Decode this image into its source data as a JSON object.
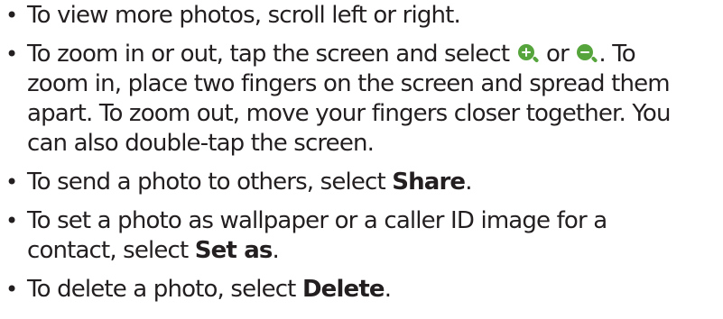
{
  "icon_color": "#56a43c",
  "bullet": "•",
  "items": [
    {
      "lines": [
        "To view more photos, scroll left or right."
      ]
    },
    {
      "line1_before": "To zoom in or out, tap the screen and select",
      "zoom_in_icon": "zoom-in-icon",
      "or": "or",
      "zoom_out_icon": "zoom-out-icon",
      "line1_after": ". To",
      "lines": [
        "zoom in, place two fingers on the screen and spread them",
        "apart. To zoom out, move your fingers closer together. You",
        "can also double-tap the screen."
      ]
    },
    {
      "before": "To send a photo to others, select",
      "bold": "Share",
      "after": "."
    },
    {
      "line1": "To set a photo as wallpaper or a caller ID image for a",
      "before": "contact, select",
      "bold": "Set as",
      "after": "."
    },
    {
      "before": "To delete a photo, select",
      "bold": "Delete",
      "after": "."
    }
  ]
}
